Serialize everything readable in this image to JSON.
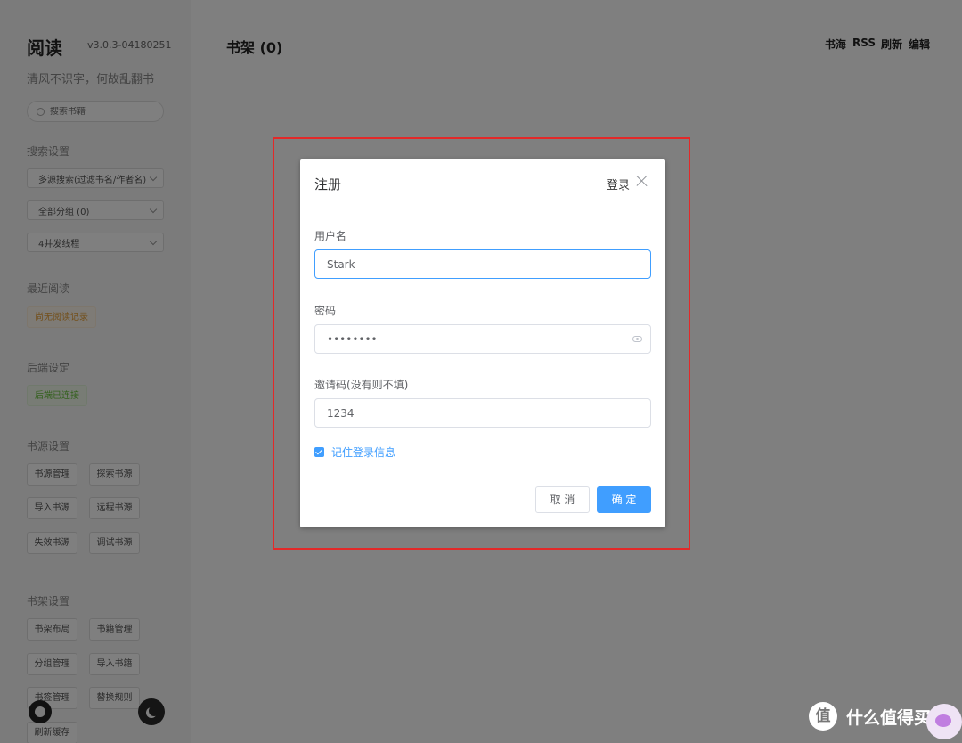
{
  "app": {
    "title": "阅读",
    "version": "v3.0.3-04180251",
    "slogan": "清风不识字，何故乱翻书",
    "search_placeholder": "搜索书籍"
  },
  "sidebar": {
    "search_settings": {
      "title": "搜索设置",
      "selects": [
        "多源搜索(过滤书名/作者名)",
        "全部分组 (0)",
        "4并发线程"
      ]
    },
    "recent_reading": {
      "title": "最近阅读",
      "tag": "尚无阅读记录"
    },
    "backend": {
      "title": "后端设定",
      "tag": "后端已连接"
    },
    "source_settings": {
      "title": "书源设置",
      "buttons": [
        "书源管理",
        "探索书源",
        "导入书源",
        "远程书源",
        "失效书源",
        "调试书源"
      ]
    },
    "shelf_settings": {
      "title": "书架设置",
      "buttons": [
        "书架布局",
        "书籍管理",
        "分组管理",
        "导入书籍",
        "书签管理",
        "替换规则",
        "刷新缓存"
      ]
    }
  },
  "main": {
    "shelf_title": "书架 (0)",
    "nav": [
      "书海",
      "RSS",
      "刷新",
      "编辑"
    ]
  },
  "dialog": {
    "title": "注册",
    "login_link": "登录",
    "username_label": "用户名",
    "username_value": "Stark",
    "password_label": "密码",
    "password_value": "••••••••",
    "invite_label": "邀请码(没有则不填)",
    "invite_value": "1234",
    "remember_label": "记住登录信息",
    "remember_checked": true,
    "cancel_label": "取 消",
    "ok_label": "确 定"
  },
  "watermark": {
    "logo_char": "值",
    "text": "什么值得买"
  },
  "colors": {
    "primary": "#409eff",
    "highlight_border": "#e32929",
    "overlay": "#808080"
  }
}
